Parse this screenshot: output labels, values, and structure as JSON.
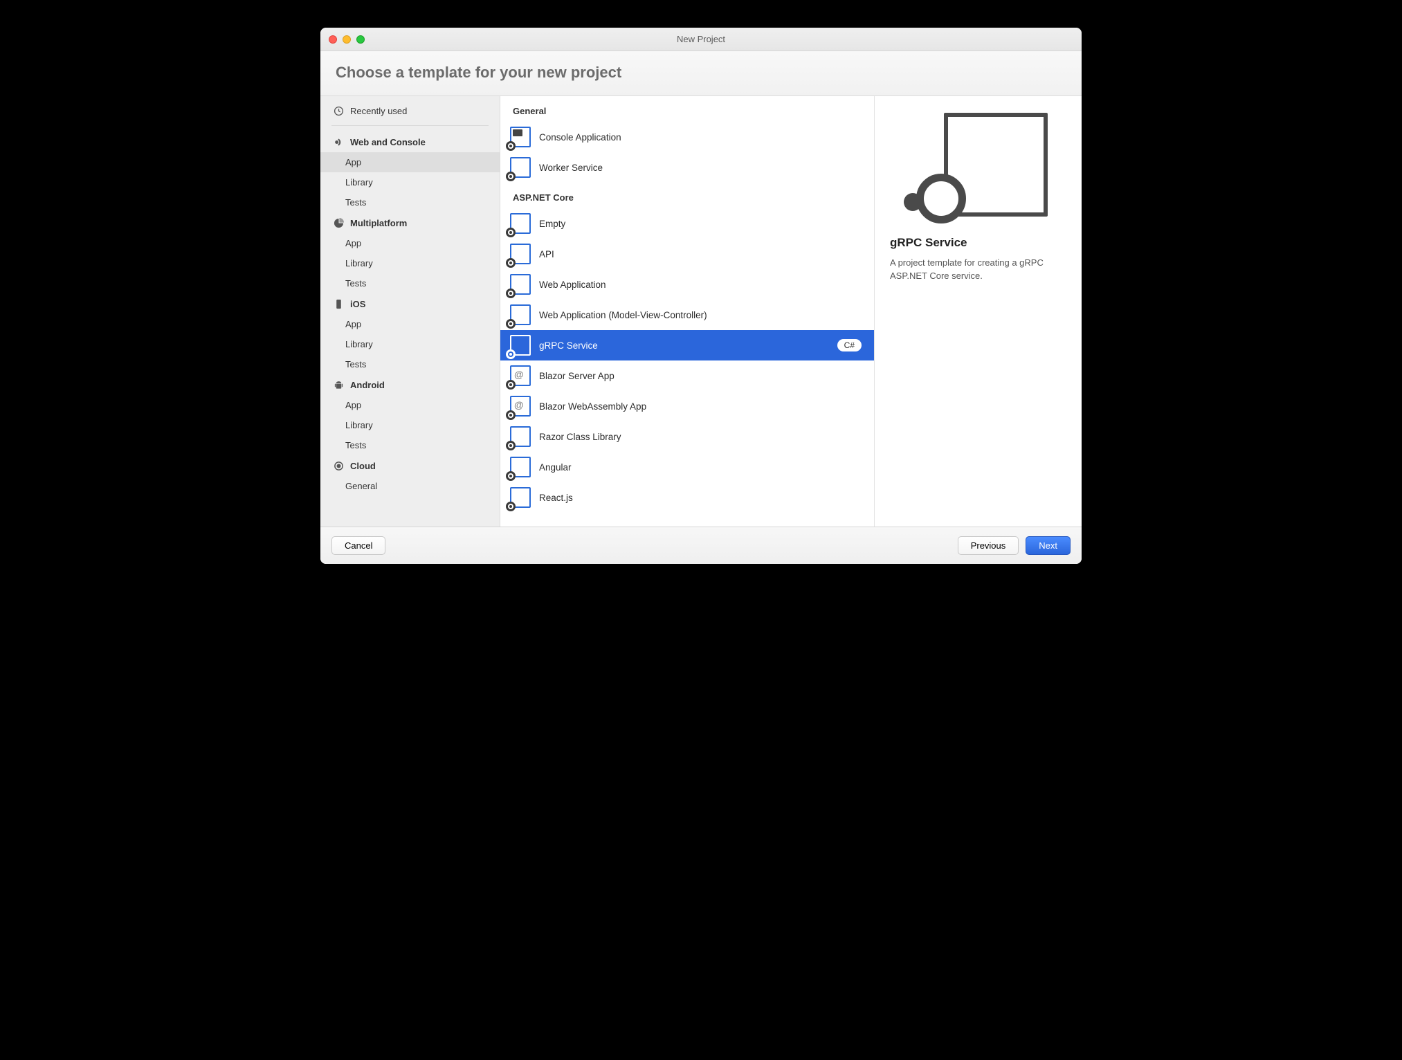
{
  "window": {
    "title": "New Project"
  },
  "header": {
    "title": "Choose a template for your new project"
  },
  "sidebar": {
    "recent": {
      "label": "Recently used"
    },
    "groups": [
      {
        "label": "Web and Console",
        "icon": "dotnet",
        "items": [
          "App",
          "Library",
          "Tests"
        ],
        "selectedIndex": 0
      },
      {
        "label": "Multiplatform",
        "icon": "pie",
        "items": [
          "App",
          "Library",
          "Tests"
        ]
      },
      {
        "label": "iOS",
        "icon": "phone",
        "items": [
          "App",
          "Library",
          "Tests"
        ]
      },
      {
        "label": "Android",
        "icon": "android",
        "items": [
          "App",
          "Library",
          "Tests"
        ]
      },
      {
        "label": "Cloud",
        "icon": "target",
        "items": [
          "General"
        ]
      }
    ]
  },
  "templates": {
    "sections": [
      {
        "title": "General",
        "items": [
          {
            "label": "Console Application",
            "style": "console"
          },
          {
            "label": "Worker Service",
            "style": "plain"
          }
        ]
      },
      {
        "title": "ASP.NET Core",
        "items": [
          {
            "label": "Empty",
            "style": "plain"
          },
          {
            "label": "API",
            "style": "plain"
          },
          {
            "label": "Web Application",
            "style": "plain"
          },
          {
            "label": "Web Application (Model-View-Controller)",
            "style": "plain"
          },
          {
            "label": "gRPC Service",
            "style": "plain",
            "selected": true,
            "badge": "C#"
          },
          {
            "label": "Blazor Server App",
            "style": "at"
          },
          {
            "label": "Blazor WebAssembly App",
            "style": "at"
          },
          {
            "label": "Razor Class Library",
            "style": "plain"
          },
          {
            "label": "Angular",
            "style": "plain"
          },
          {
            "label": "React.js",
            "style": "plain"
          }
        ]
      }
    ]
  },
  "details": {
    "title": "gRPC Service",
    "description": "A project template for creating a gRPC ASP.NET Core service."
  },
  "footer": {
    "cancel": "Cancel",
    "previous": "Previous",
    "next": "Next"
  }
}
